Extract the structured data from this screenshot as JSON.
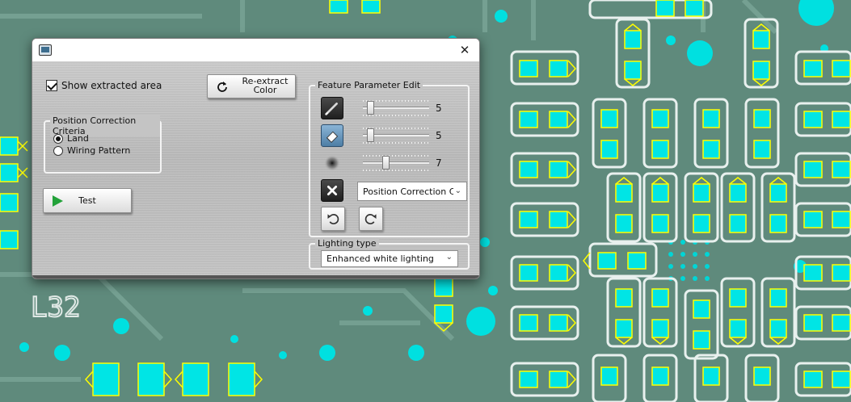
{
  "window": {
    "close_glyph": "✕"
  },
  "show_extracted": {
    "label": "Show extracted area",
    "checked": true
  },
  "reextract_button": {
    "line1": "Re-extract",
    "line2": "Color"
  },
  "position_correction": {
    "title": "Position Correction Criteria",
    "options": [
      {
        "label": "Land",
        "selected": true
      },
      {
        "label": "Wiring Pattern",
        "selected": false
      }
    ]
  },
  "test_button": {
    "label": "Test"
  },
  "feature_edit": {
    "title": "Feature Parameter Edit",
    "sliders": [
      {
        "tool": "pen",
        "value": "5",
        "fraction": 0.07
      },
      {
        "tool": "eraser",
        "value": "5",
        "fraction": 0.07
      },
      {
        "tool": "blur",
        "value": "7",
        "fraction": 0.33
      }
    ],
    "position_color_select": {
      "value": "Position Correction Colo"
    }
  },
  "lighting": {
    "title": "Lighting type",
    "value": "Enhanced white lighting"
  },
  "colors": {
    "pcb_green": "#5f8a7c",
    "pad_cyan": "#00e5e5",
    "outline_yellow": "#ffff00",
    "silk_white": "#e8f0ee"
  }
}
